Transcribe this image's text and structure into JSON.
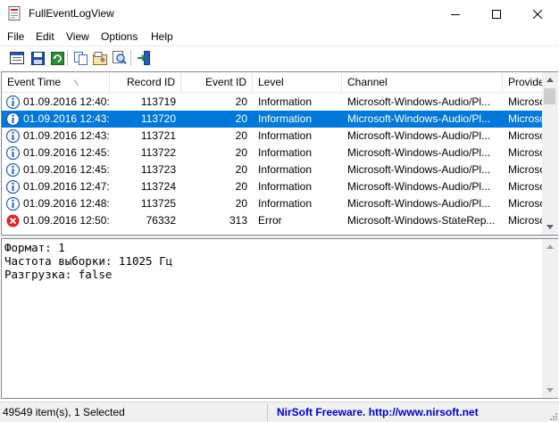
{
  "window": {
    "title": "FullEventLogView",
    "icon": "fulleventlogview-app-icon",
    "controls": [
      "minimize-icon",
      "maximize-icon",
      "close-icon"
    ]
  },
  "menu": [
    "File",
    "Edit",
    "View",
    "Options",
    "Help"
  ],
  "toolbar": {
    "icons": [
      "options-icon",
      "save-icon",
      "refresh-icon",
      "copy-icon",
      "properties-icon",
      "find-icon",
      "exit-icon"
    ]
  },
  "table": {
    "columns": [
      "Event Time",
      "Record ID",
      "Event ID",
      "Level",
      "Channel",
      "Provide"
    ],
    "sorted_by": "Event Time",
    "rows": [
      {
        "icon": "info-icon",
        "time": "01.09.2016 12:40:...",
        "record": "113719",
        "event": "20",
        "level": "Information",
        "channel": "Microsoft-Windows-Audio/Pl...",
        "provider": "Microso",
        "selected": false
      },
      {
        "icon": "info-icon",
        "time": "01.09.2016 12:43:...",
        "record": "113720",
        "event": "20",
        "level": "Information",
        "channel": "Microsoft-Windows-Audio/Pl...",
        "provider": "Microso",
        "selected": true
      },
      {
        "icon": "info-icon",
        "time": "01.09.2016 12:43:...",
        "record": "113721",
        "event": "20",
        "level": "Information",
        "channel": "Microsoft-Windows-Audio/Pl...",
        "provider": "Microso",
        "selected": false
      },
      {
        "icon": "info-icon",
        "time": "01.09.2016 12:45:...",
        "record": "113722",
        "event": "20",
        "level": "Information",
        "channel": "Microsoft-Windows-Audio/Pl...",
        "provider": "Microso",
        "selected": false
      },
      {
        "icon": "info-icon",
        "time": "01.09.2016 12:45:...",
        "record": "113723",
        "event": "20",
        "level": "Information",
        "channel": "Microsoft-Windows-Audio/Pl...",
        "provider": "Microso",
        "selected": false
      },
      {
        "icon": "info-icon",
        "time": "01.09.2016 12:47:...",
        "record": "113724",
        "event": "20",
        "level": "Information",
        "channel": "Microsoft-Windows-Audio/Pl...",
        "provider": "Microso",
        "selected": false
      },
      {
        "icon": "info-icon",
        "time": "01.09.2016 12:48:...",
        "record": "113725",
        "event": "20",
        "level": "Information",
        "channel": "Microsoft-Windows-Audio/Pl...",
        "provider": "Microso",
        "selected": false
      },
      {
        "icon": "error-icon",
        "time": "01.09.2016 12:50:...",
        "record": "76332",
        "event": "313",
        "level": "Error",
        "channel": "Microsoft-Windows-StateRep...",
        "provider": "Microso",
        "selected": false
      }
    ]
  },
  "details": {
    "lines": [
      "Формат: 1",
      "Частота выборки: 11025 Гц",
      "Разгрузка: false"
    ]
  },
  "status": {
    "count": "49549 item(s), 1 Selected",
    "credit": "NirSoft Freeware.  http://www.nirsoft.net"
  },
  "colors": {
    "selection": "#0078d7",
    "info_icon": "#1e5bb5",
    "error_icon": "#d9262a",
    "credit_text": "#0000cc"
  }
}
